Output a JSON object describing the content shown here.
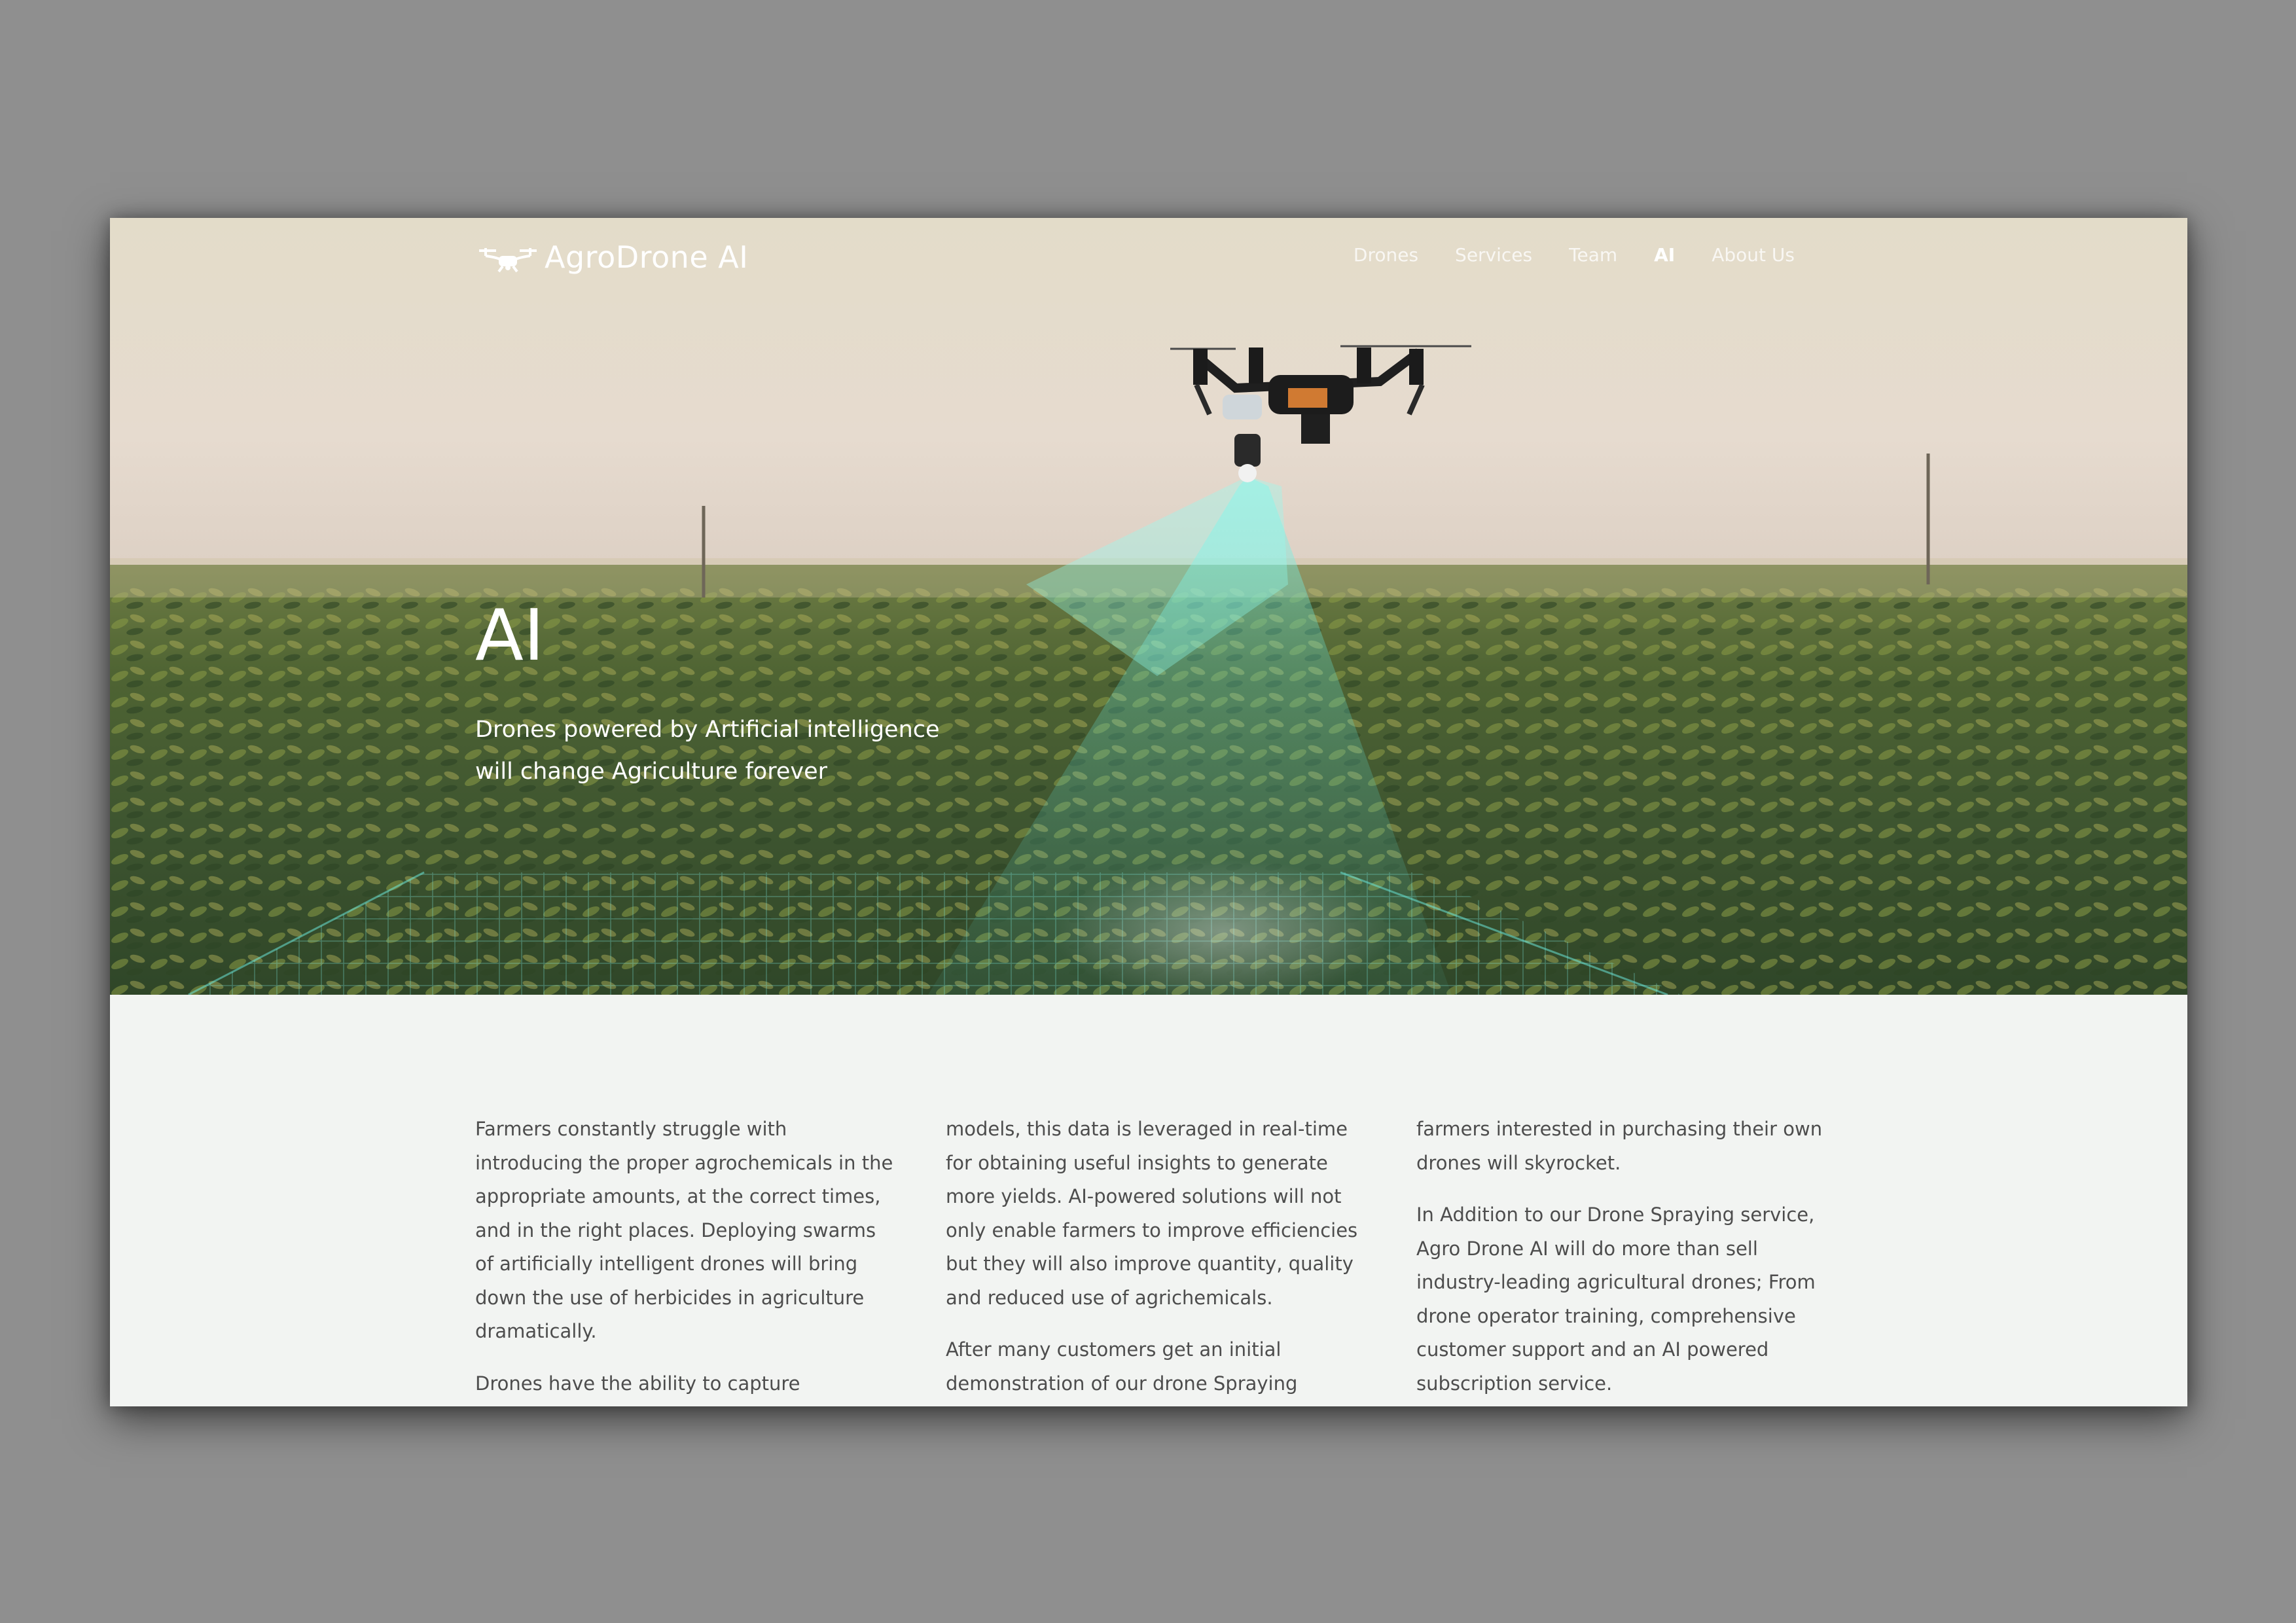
{
  "brand": {
    "name": "AgroDrone AI",
    "logo_icon": "drone-icon"
  },
  "nav": {
    "items": [
      {
        "label": "Drones",
        "active": false
      },
      {
        "label": "Services",
        "active": false
      },
      {
        "label": "Team",
        "active": false
      },
      {
        "label": "AI",
        "active": true
      },
      {
        "label": "About Us",
        "active": false
      }
    ]
  },
  "hero": {
    "title": "AI",
    "subtitle_line1": "Drones powered by Artificial intelligence",
    "subtitle_line2": "will change Agriculture forever",
    "beam_color": "#6ff2e6"
  },
  "content": {
    "col1": [
      "Farmers constantly struggle with introducing the proper agrochemicals in the appropriate amounts, at the correct times, and in the right places. Deploying swarms of artificially intelligent drones will bring down the use of herbicides in agriculture dramatically.",
      "Drones have the ability to capture enormous amounts of useful data. With the help of"
    ],
    "col2": [
      "models, this data is leveraged in real-time for obtaining useful insights to generate more yields. AI-powered solutions will not only enable farmers to improve efficiencies but they will also improve quantity, quality and reduced use of agrichemicals.",
      "After many customers get an initial demonstration of our drone Spraying service"
    ],
    "col3": [
      "farmers interested in  purchasing their own drones  will skyrocket.",
      "In Addition to our Drone Spraying service, Agro Drone AI will do more than sell industry-leading agricultural drones; From drone operator training, comprehensive customer support and an AI powered subscription service."
    ]
  }
}
